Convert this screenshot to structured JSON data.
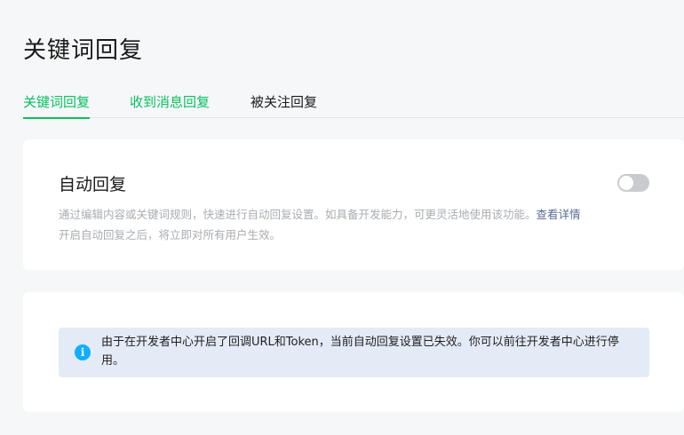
{
  "page": {
    "title": "关键词回复"
  },
  "tabs": [
    {
      "label": "关键词回复",
      "active": true
    },
    {
      "label": "收到消息回复",
      "active": false
    },
    {
      "label": "被关注回复",
      "active": false
    }
  ],
  "auto_reply": {
    "title": "自动回复",
    "enabled": false,
    "desc_line1": "通过编辑内容或关键词规则，快速进行自动回复设置。如具备开发能力，可更灵活地使用该功能。",
    "detail_link": "查看详情",
    "desc_line2": "开启自动回复之后，将立即对所有用户生效。"
  },
  "notice": {
    "icon": "info-icon",
    "text": "由于在开发者中心开启了回调URL和Token，当前自动回复设置已失效。你可以前往开发者中心进行停用。"
  },
  "colors": {
    "accent": "#07c160",
    "link": "#576b95",
    "info": "#10aeff"
  }
}
